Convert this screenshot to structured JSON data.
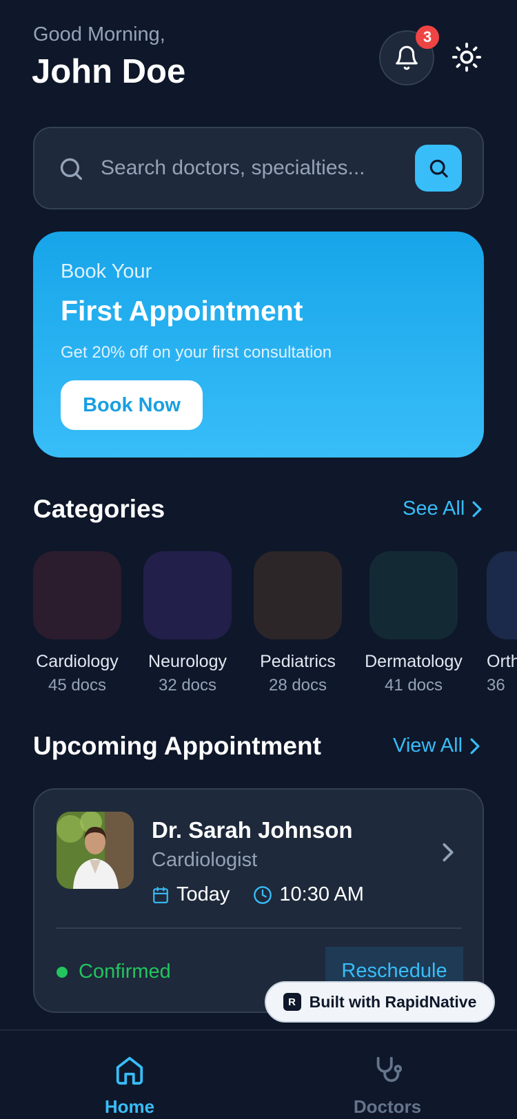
{
  "header": {
    "greeting": "Good Morning,",
    "username": "John Doe",
    "notification_count": "3"
  },
  "search": {
    "placeholder": "Search doctors, specialties..."
  },
  "banner": {
    "kicker": "Book Your",
    "title": "First Appointment",
    "subtitle": "Get 20% off on your first consultation",
    "cta_label": "Book Now"
  },
  "categories": {
    "title": "Categories",
    "see_all_label": "See All",
    "items": [
      {
        "name": "Cardiology",
        "count": "45 docs",
        "color": "#2b1d2e"
      },
      {
        "name": "Neurology",
        "count": "32 docs",
        "color": "#221f4a"
      },
      {
        "name": "Pediatrics",
        "count": "28 docs",
        "color": "#2d2628"
      },
      {
        "name": "Dermatology",
        "count": "41 docs",
        "color": "#132a35"
      },
      {
        "name": "Orth",
        "count": "36",
        "color": "#1b2a4a"
      }
    ]
  },
  "upcoming": {
    "title": "Upcoming Appointment",
    "view_all_label": "View All",
    "doctor_name": "Dr. Sarah Johnson",
    "specialty": "Cardiologist",
    "date": "Today",
    "time": "10:30 AM",
    "status": "Confirmed",
    "reschedule_label": "Reschedule"
  },
  "badge": {
    "label": "Built with RapidNative"
  },
  "bottom_nav": {
    "items": [
      {
        "label": "Home",
        "icon": "home-icon",
        "active": true
      },
      {
        "label": "Doctors",
        "icon": "stethoscope-icon",
        "active": false
      }
    ]
  },
  "colors": {
    "background": "#0f172a",
    "surface": "#1e293b",
    "accent": "#38bdf8",
    "success": "#22c55e",
    "danger": "#ef4444"
  }
}
